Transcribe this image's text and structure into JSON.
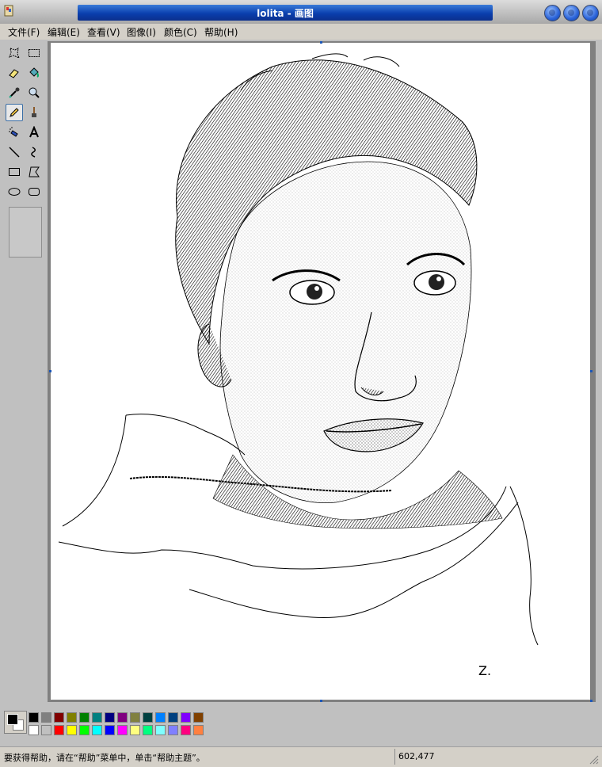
{
  "window": {
    "title": "lolita - 画图"
  },
  "menu": [
    {
      "label": "文件(F)"
    },
    {
      "label": "编辑(E)"
    },
    {
      "label": "查看(V)"
    },
    {
      "label": "图像(I)"
    },
    {
      "label": "颜色(C)"
    },
    {
      "label": "帮助(H)"
    }
  ],
  "tools": [
    {
      "name": "free-select-icon"
    },
    {
      "name": "rect-select-icon"
    },
    {
      "name": "eraser-icon"
    },
    {
      "name": "fill-icon"
    },
    {
      "name": "color-picker-icon"
    },
    {
      "name": "magnifier-icon"
    },
    {
      "name": "pencil-icon",
      "active": true
    },
    {
      "name": "brush-icon"
    },
    {
      "name": "airbrush-icon"
    },
    {
      "name": "text-icon"
    },
    {
      "name": "line-icon"
    },
    {
      "name": "curve-icon"
    },
    {
      "name": "rectangle-icon"
    },
    {
      "name": "polygon-icon"
    },
    {
      "name": "ellipse-icon"
    },
    {
      "name": "rounded-rect-icon"
    }
  ],
  "canvas": {
    "signature": "Z."
  },
  "palette": {
    "foreground": "#000000",
    "background": "#ffffff",
    "row1": [
      "#000000",
      "#808080",
      "#800000",
      "#808000",
      "#008000",
      "#008080",
      "#000080",
      "#800080",
      "#808040",
      "#004040",
      "#0080ff",
      "#004080",
      "#8000ff",
      "#804000"
    ],
    "row2": [
      "#ffffff",
      "#c0c0c0",
      "#ff0000",
      "#ffff00",
      "#00ff00",
      "#00ffff",
      "#0000ff",
      "#ff00ff",
      "#ffff80",
      "#00ff80",
      "#80ffff",
      "#8080ff",
      "#ff0080",
      "#ff8040"
    ]
  },
  "status": {
    "help_text": "要获得帮助，请在“帮助”菜单中，单击“帮助主题”。",
    "coords": "602,477"
  }
}
